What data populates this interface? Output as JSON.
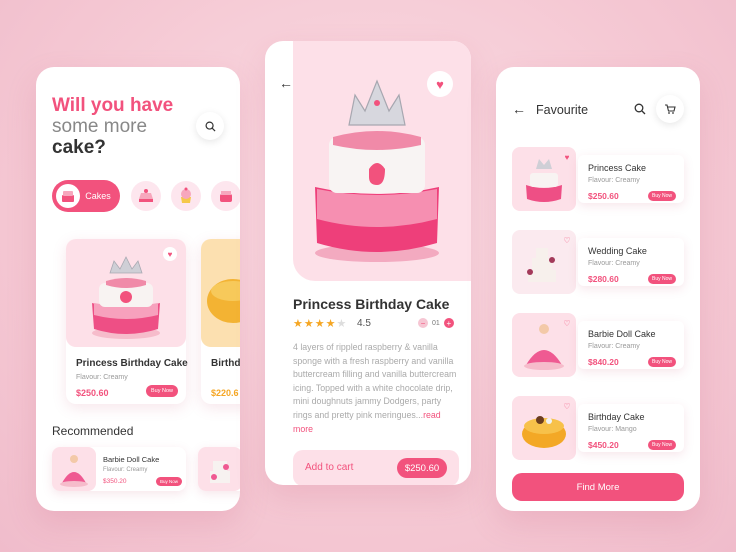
{
  "home": {
    "heading_line1": "Will you have",
    "heading_line2": "some more",
    "heading_line3": "cake?",
    "category_active_label": "Cakes",
    "cards": [
      {
        "name": "Princess Birthday Cake",
        "flavour": "Flavour: Creamy",
        "price": "$250.60",
        "buy": "Buy Now"
      },
      {
        "name": "Birthd",
        "price": "$220.6"
      }
    ],
    "recommended_title": "Recommended",
    "recommended": [
      {
        "name": "Barbie Doll Cake",
        "flavour": "Flavour: Creamy",
        "price": "$350.20",
        "buy": "Buy Now"
      }
    ]
  },
  "detail": {
    "title": "Princess Birthday Cake",
    "stars_filled": "★★★★",
    "stars_empty": "★",
    "rating": "4.5",
    "quantity": "01",
    "description": "4 layers of rippled raspberry & vanilla sponge with a fresh raspberry and vanilla buttercream filling and vanilla buttercream icing. Topped with a white chocolate drip, mini doughnuts jammy Dodgers, party rings and pretty pink meringues...",
    "read_more": "read more",
    "add_to_cart": "Add to cart",
    "price": "$250.60"
  },
  "favourite": {
    "title": "Favourite",
    "items": [
      {
        "name": "Princess Cake",
        "flavour": "Flavour: Creamy",
        "price": "$250.60",
        "buy": "Buy Now"
      },
      {
        "name": "Wedding Cake",
        "flavour": "Flavour: Creamy",
        "price": "$280.60",
        "buy": "Buy Now"
      },
      {
        "name": "Barbie Doll Cake",
        "flavour": "Flavour: Creamy",
        "price": "$840.20",
        "buy": "Buy Now"
      },
      {
        "name": "Birthday Cake",
        "flavour": "Flavour: Mango",
        "price": "$450.20",
        "buy": "Buy Now"
      }
    ],
    "find_more": "Find More"
  },
  "colors": {
    "accent": "#f2527d",
    "soft": "#fde0e8"
  },
  "icons": [
    "search-icon",
    "heart-icon",
    "back-arrow-icon",
    "cart-icon",
    "star-icon",
    "minus-icon",
    "plus-icon"
  ]
}
